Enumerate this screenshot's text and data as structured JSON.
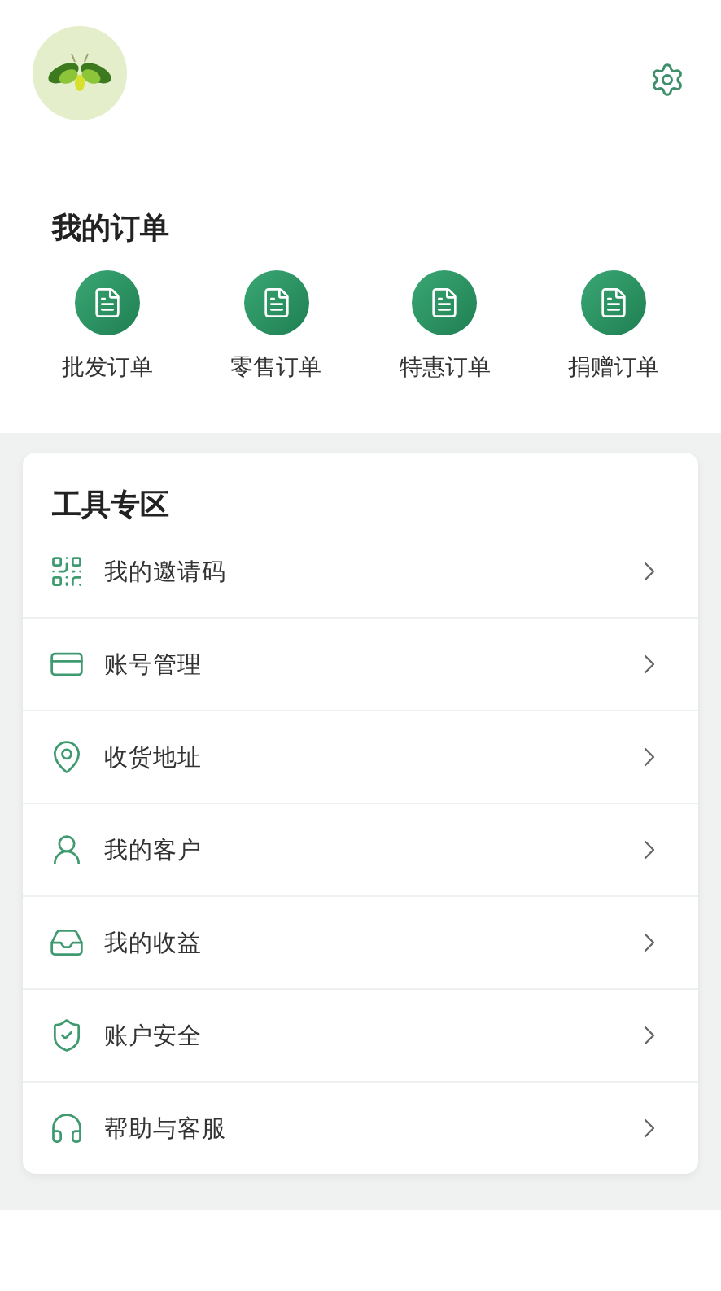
{
  "orders": {
    "title": "我的订单",
    "items": [
      {
        "label": "批发订单"
      },
      {
        "label": "零售订单"
      },
      {
        "label": "特惠订单"
      },
      {
        "label": "捐赠订单"
      }
    ]
  },
  "tools": {
    "title": "工具专区",
    "items": [
      {
        "label": "我的邀请码",
        "kind": "qr"
      },
      {
        "label": "账号管理",
        "kind": "card"
      },
      {
        "label": "收货地址",
        "kind": "pin"
      },
      {
        "label": "我的客户",
        "kind": "user"
      },
      {
        "label": "我的收益",
        "kind": "inbox"
      },
      {
        "label": "账户安全",
        "kind": "shield"
      },
      {
        "label": "帮助与客服",
        "kind": "headset"
      }
    ]
  }
}
